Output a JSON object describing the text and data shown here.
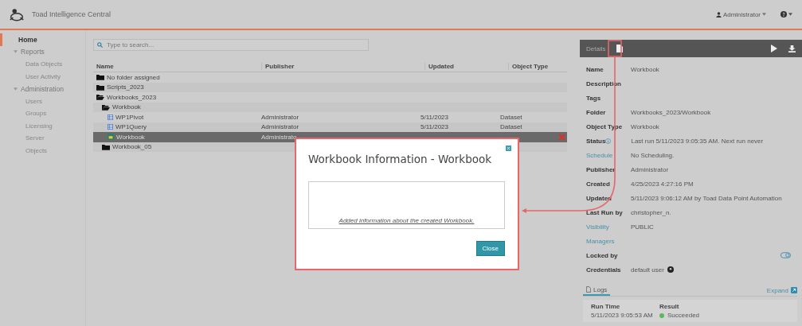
{
  "header": {
    "app_title": "Toad Intelligence Central",
    "user_menu": "Administrator"
  },
  "sidebar": {
    "items": [
      {
        "label": "Home",
        "selected": true
      },
      {
        "label": "Reports",
        "selected": false,
        "expanded": true,
        "children": [
          {
            "label": "Data Objects",
            "selected": false
          },
          {
            "label": "User Activity",
            "selected": false
          }
        ]
      },
      {
        "label": "Administration",
        "selected": false,
        "expanded": true,
        "children": [
          {
            "label": "Users",
            "selected": false
          },
          {
            "label": "Groups",
            "selected": false
          },
          {
            "label": "Licensing",
            "selected": false
          },
          {
            "label": "Server",
            "selected": false
          },
          {
            "label": "Objects",
            "selected": false
          }
        ]
      }
    ]
  },
  "search": {
    "placeholder": "Type to search..."
  },
  "table": {
    "columns": [
      "Name",
      "Publisher",
      "Updated",
      "Object Type"
    ],
    "rows": [
      {
        "kind": "folder",
        "name": "No folder assigned",
        "selected": false
      },
      {
        "kind": "folder",
        "name": "Scripts_2023",
        "selected": false
      },
      {
        "kind": "folder",
        "name": "Workbooks_2023",
        "selected": false,
        "expanded": true,
        "children": [
          {
            "kind": "folder",
            "name": "Workbook",
            "selected": false,
            "expanded": true,
            "children": [
              {
                "kind": "dataset",
                "name": "WP1Pivot",
                "publisher": "Administrator",
                "updated": "5/11/2023",
                "object_type": "Dataset",
                "selected": false
              },
              {
                "kind": "dataset",
                "name": "WP1Query",
                "publisher": "Administrator",
                "updated": "5/11/2023",
                "object_type": "Dataset",
                "selected": false
              },
              {
                "kind": "workbook",
                "name": "Workbook",
                "publisher": "Administrato",
                "selected": true
              }
            ]
          },
          {
            "kind": "folder",
            "name": "Workbook_05",
            "selected": false
          }
        ]
      }
    ]
  },
  "details": {
    "title": "Details",
    "fields": [
      {
        "label": "Name",
        "value": "Workbook",
        "kind": "plain"
      },
      {
        "label": "Description",
        "kind": "plain"
      },
      {
        "label": "Tags",
        "kind": "plain"
      },
      {
        "label": "Folder",
        "value": "Workbooks_2023/Workbook",
        "kind": "plain"
      },
      {
        "label": "Object Type",
        "value": "Workbook",
        "kind": "plain"
      },
      {
        "label": "Status",
        "value": "Last run 5/11/2023 9:05:35 AM. Next run never",
        "kind": "info"
      },
      {
        "label": "Schedule",
        "value": "No Scheduling.",
        "kind": "link"
      },
      {
        "label": "Publisher",
        "value": "Administrator",
        "kind": "plain"
      },
      {
        "label": "Created",
        "value": "4/25/2023 4:27:16 PM",
        "kind": "plain"
      },
      {
        "label": "Updated",
        "value": "5/11/2023 9:06:12 AM by Toad Data Point Automation",
        "kind": "plain"
      },
      {
        "label": "Last Run by",
        "value": "christopher_n.",
        "kind": "plain"
      },
      {
        "label": "Visibility",
        "value": "PUBLIC",
        "kind": "link"
      },
      {
        "label": "Managers",
        "kind": "link"
      },
      {
        "label": "Locked by",
        "kind": "toggle"
      },
      {
        "label": "Credentials",
        "value": "default user",
        "kind": "credential"
      }
    ],
    "logs": {
      "tab": "Logs",
      "expand": "Expand",
      "columns": [
        "Run Time",
        "Result"
      ],
      "rows": [
        {
          "run_time": "5/11/2023 9:05:53 AM",
          "result": "Succeeded",
          "color": "#5cb85c"
        }
      ]
    }
  },
  "modal": {
    "title": "Workbook Information - Workbook",
    "body": "Added information about the created Workbook.",
    "button": "Close"
  }
}
